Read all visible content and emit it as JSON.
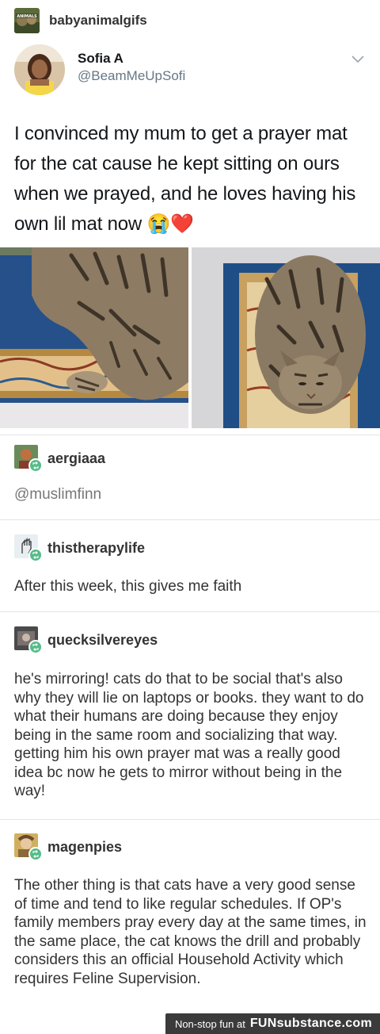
{
  "post": {
    "username": "babyanimalgifs",
    "avatar_text": "ANIMALS"
  },
  "tweet": {
    "name": "Sofia A",
    "handle": "@BeamMeUpSofi",
    "text": "I convinced my mum to get a prayer mat for the cat cause he kept sitting on ours when we prayed, and he loves having his own lil mat now 😭❤️"
  },
  "reblogs": [
    {
      "username": "aergiaaa",
      "text": "@muslimfinn",
      "style": "muted"
    },
    {
      "username": "thistherapylife",
      "text": "After this week, this gives me faith"
    },
    {
      "username": "quecksilvereyes",
      "text": "he's mirroring! cats do that to be social that's also why they will lie on laptops or books. they want to do what their humans are doing because they enjoy being in the same room and socializing that way. getting him his own prayer mat was a really good idea bc now he gets to mirror without being in the way!"
    },
    {
      "username": "magenpies",
      "text": "The other thing is that cats have a very good sense of time and tend to like regular schedules. If OP's family members pray every day at the same times, in the same place, the cat knows the drill and probably considers this an official Household Activity which requires Feline Supervision."
    }
  ],
  "footer": {
    "text": "Non-stop fun at",
    "brand": "FUNsubstance.com"
  },
  "colors": {
    "reblog_badge": "#56bc8a",
    "handle": "#657786",
    "footer_bg": "#3b3b3b"
  },
  "icons": [
    "chevron-down-icon",
    "reblog-icon"
  ]
}
